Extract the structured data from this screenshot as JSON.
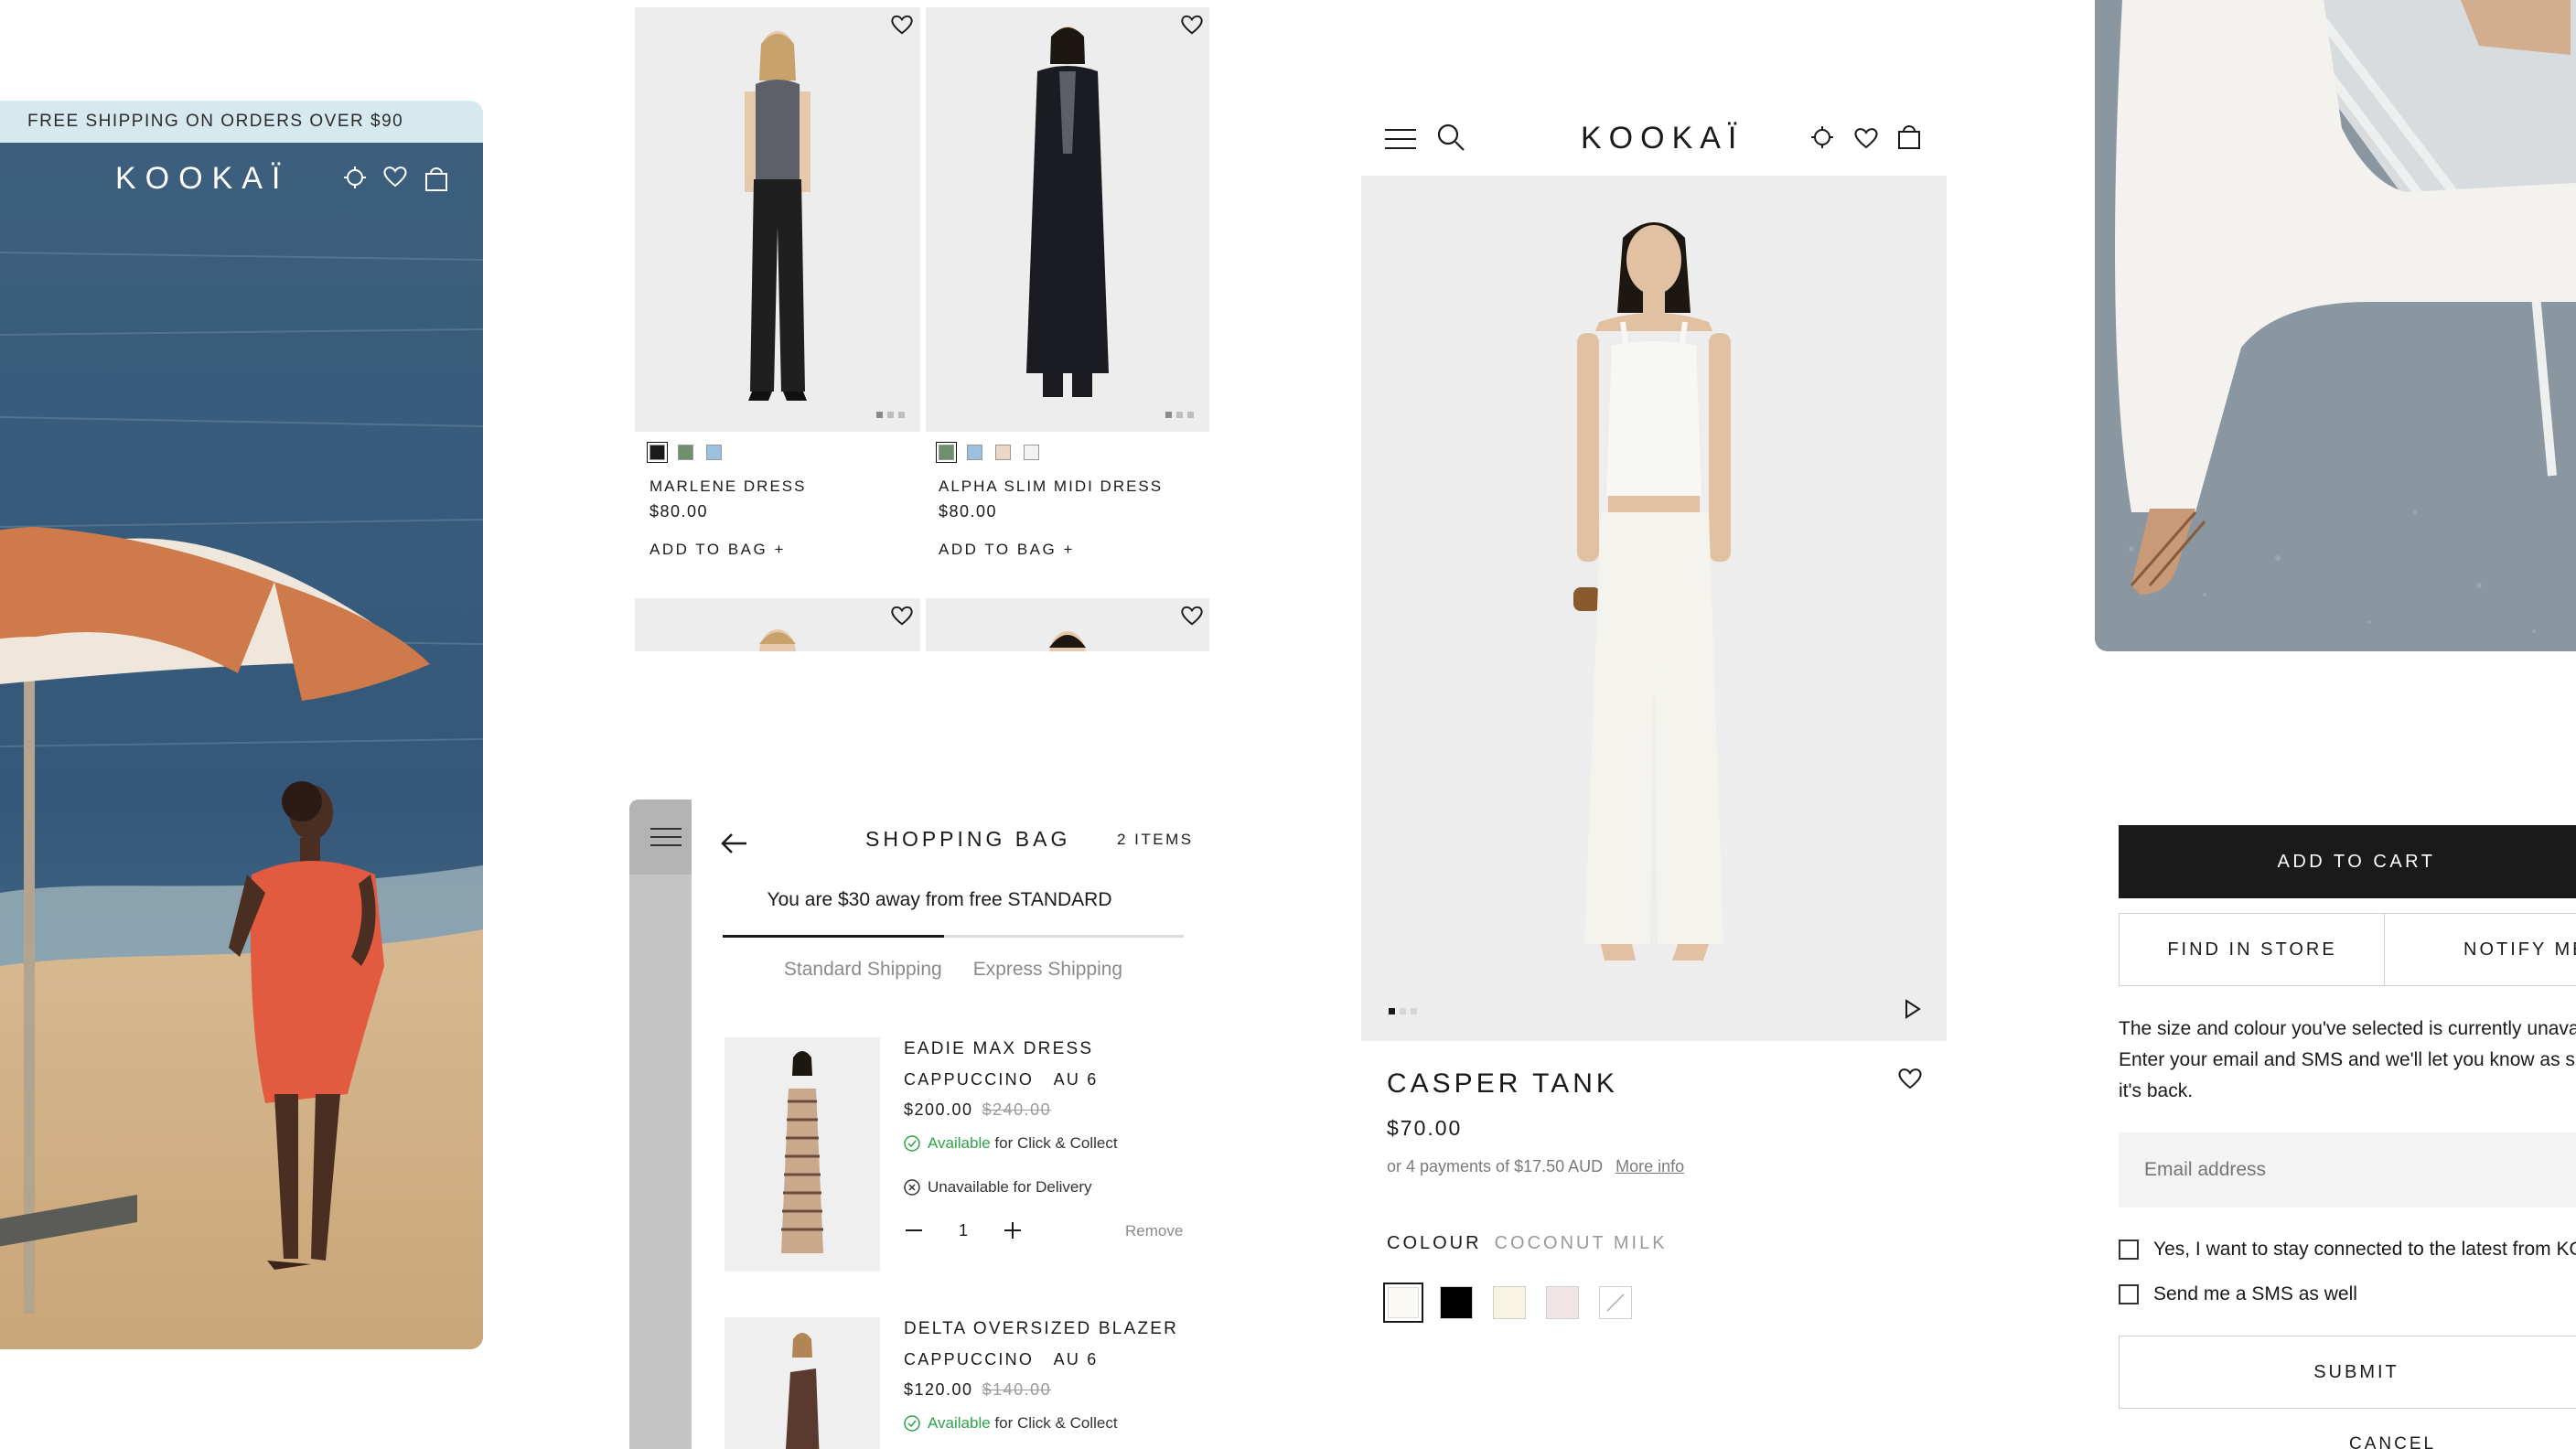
{
  "hero": {
    "promo": "FREE SHIPPING ON ORDERS OVER $90",
    "logo": "KOOKAÏ",
    "icons": [
      "location-icon",
      "heart-icon",
      "bag-icon"
    ]
  },
  "grid": {
    "products": [
      {
        "name": "MARLENE DRESS",
        "price": "$80.00",
        "add": "ADD TO BAG +",
        "swatches": [
          "#1a1a1a",
          "#6f8f6f",
          "#9cc0e0"
        ],
        "selected": 0,
        "image_count": 3
      },
      {
        "name": "ALPHA SLIM MIDI DRESS",
        "price": "$80.00",
        "add": "ADD TO BAG +",
        "swatches": [
          "#6f8f6f",
          "#9cc0e0",
          "#ecd6c6",
          "#f3f3f3"
        ],
        "selected": 0,
        "image_count": 3
      }
    ]
  },
  "bag": {
    "title": "SHOPPING BAG",
    "count": "2 ITEMS",
    "threshold": "You are $30 away from free STANDARD",
    "progress": 0.48,
    "tabs": [
      "Standard Shipping",
      "Express Shipping"
    ],
    "items": [
      {
        "name": "EADIE MAX DRESS",
        "colour": "CAPPUCCINO",
        "size": "AU 6",
        "price": "$200.00",
        "was": "$240.00",
        "available_word": "Available",
        "available_rest": " for Click & Collect",
        "unavailable": "Unavailable for Delivery",
        "qty": "1",
        "remove": "Remove"
      },
      {
        "name": "DELTA OVERSIZED BLAZER",
        "colour": "CAPPUCCINO",
        "size": "AU 6",
        "price": "$120.00",
        "was": "$140.00",
        "available_word": "Available",
        "available_rest": " for Click & Collect"
      }
    ]
  },
  "pdp": {
    "logo": "KOOKAÏ",
    "name": "CASPER TANK",
    "price": "$70.00",
    "payments": "or 4 payments of $17.50 AUD",
    "more_info": "More info",
    "colour_label": "COLOUR",
    "colour_value": "COCONUT MILK",
    "swatches": [
      "#fbf9f4",
      "#000000",
      "#f8f3e2",
      "#f1e4e4",
      "#ffffff"
    ],
    "image_count": 3,
    "accent": "#1a1a1a"
  },
  "notify": {
    "add_to_cart": "ADD TO CART",
    "find_in_store": "FIND IN STORE",
    "notify_me": "NOTIFY ME",
    "message_1": "The size and colour you've selected is currently unavai",
    "message_2": "Enter your email and SMS and we'll let you know as s",
    "message_3": "it's back.",
    "email_placeholder": "Email address",
    "opt_in": "Yes, I want to stay connected to the latest from KO",
    "sms": "Send me a SMS as well",
    "submit": "SUBMIT",
    "cancel": "CANCEL"
  }
}
